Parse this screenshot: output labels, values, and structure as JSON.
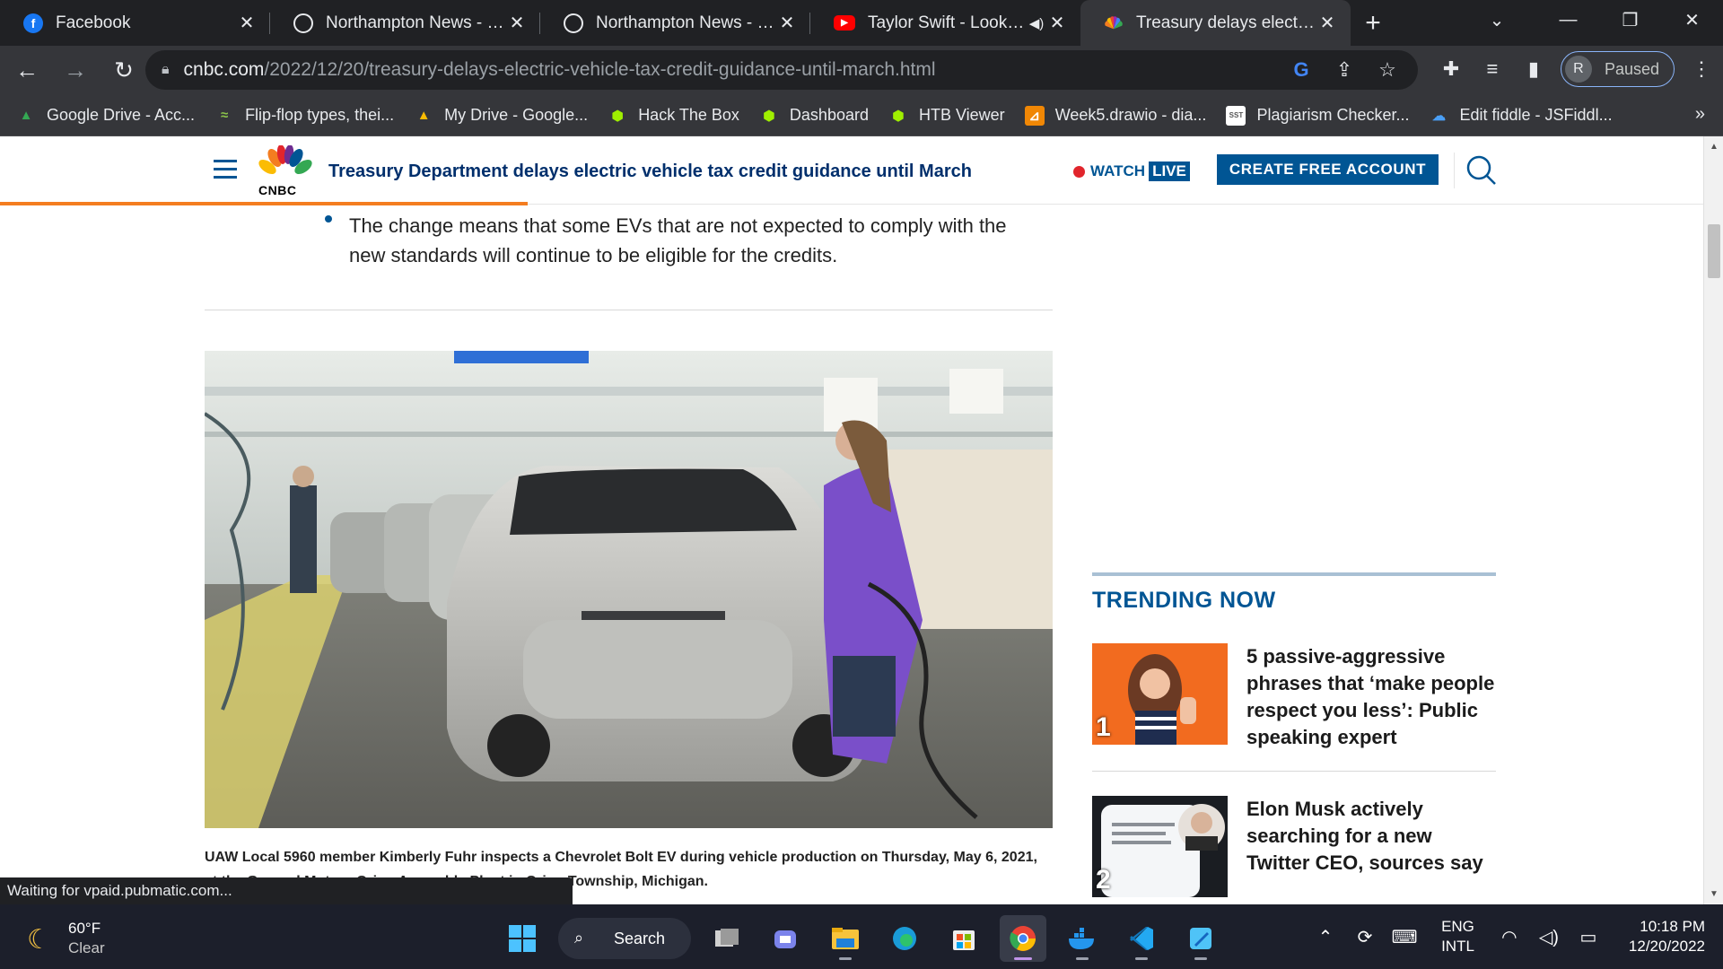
{
  "tabs": [
    {
      "title": "Facebook",
      "favicon": "facebook-icon",
      "color": "#1877f2"
    },
    {
      "title": "Northampton News - Hom",
      "favicon": "globe-icon",
      "color": "#9aa0a6"
    },
    {
      "title": "Northampton News - Hom",
      "favicon": "globe-icon",
      "color": "#9aa0a6"
    },
    {
      "title": "Taylor Swift - Look W",
      "favicon": "youtube-icon",
      "color": "#ff0000"
    },
    {
      "title": "Treasury delays electric ve",
      "favicon": "nbc-peacock-icon",
      "color": "#fbbc04"
    }
  ],
  "url": {
    "host": "cnbc.com",
    "path": "/2022/12/20/treasury-delays-electric-vehicle-tax-credit-guidance-until-march.html"
  },
  "profile": {
    "initial": "R",
    "label": "Paused"
  },
  "bookmarks": [
    {
      "label": "Google Drive - Acc...",
      "icon": "google-drive-icon"
    },
    {
      "label": "Flip-flop types, thei...",
      "icon": "flipflop-icon"
    },
    {
      "label": "My Drive - Google...",
      "icon": "google-drive-icon"
    },
    {
      "label": "Hack The Box",
      "icon": "hackthebox-icon"
    },
    {
      "label": "Dashboard",
      "icon": "hackthebox-icon"
    },
    {
      "label": "HTB Viewer",
      "icon": "hackthebox-icon"
    },
    {
      "label": "Week5.drawio - dia...",
      "icon": "drawio-icon"
    },
    {
      "label": "Plagiarism Checker...",
      "icon": "sst-icon"
    },
    {
      "label": "Edit fiddle - JSFiddl...",
      "icon": "jsfiddle-icon"
    }
  ],
  "header": {
    "headline": "Treasury Department delays electric vehicle tax credit guidance until March",
    "watch": "WATCH",
    "live": "LIVE",
    "cta": "CREATE FREE ACCOUNT",
    "logo_text": "CNBC",
    "read_progress": 0.31
  },
  "article": {
    "bullet": "The change means that some EVs that are not expected to comply with the new standards will continue to be eligible for the credits.",
    "caption": "UAW Local 5960 member Kimberly Fuhr inspects a Chevrolet Bolt EV during vehicle production on Thursday, May 6, 2021, at the General Motors Orion Assembly Plant in Orion Township, Michigan."
  },
  "trending": {
    "title": "TRENDING NOW",
    "items": [
      {
        "rank": "1",
        "headline": "5 passive-aggressive phrases that ‘make people respect you less’: Public speaking expert"
      },
      {
        "rank": "2",
        "headline": "Elon Musk actively searching for a new Twitter CEO, sources say"
      }
    ]
  },
  "status": "Waiting for vpaid.pubmatic.com...",
  "taskbar": {
    "temp": "60°F",
    "condition": "Clear",
    "search": "Search",
    "lang1": "ENG",
    "lang2": "INTL",
    "time": "10:18 PM",
    "date": "12/20/2022"
  }
}
